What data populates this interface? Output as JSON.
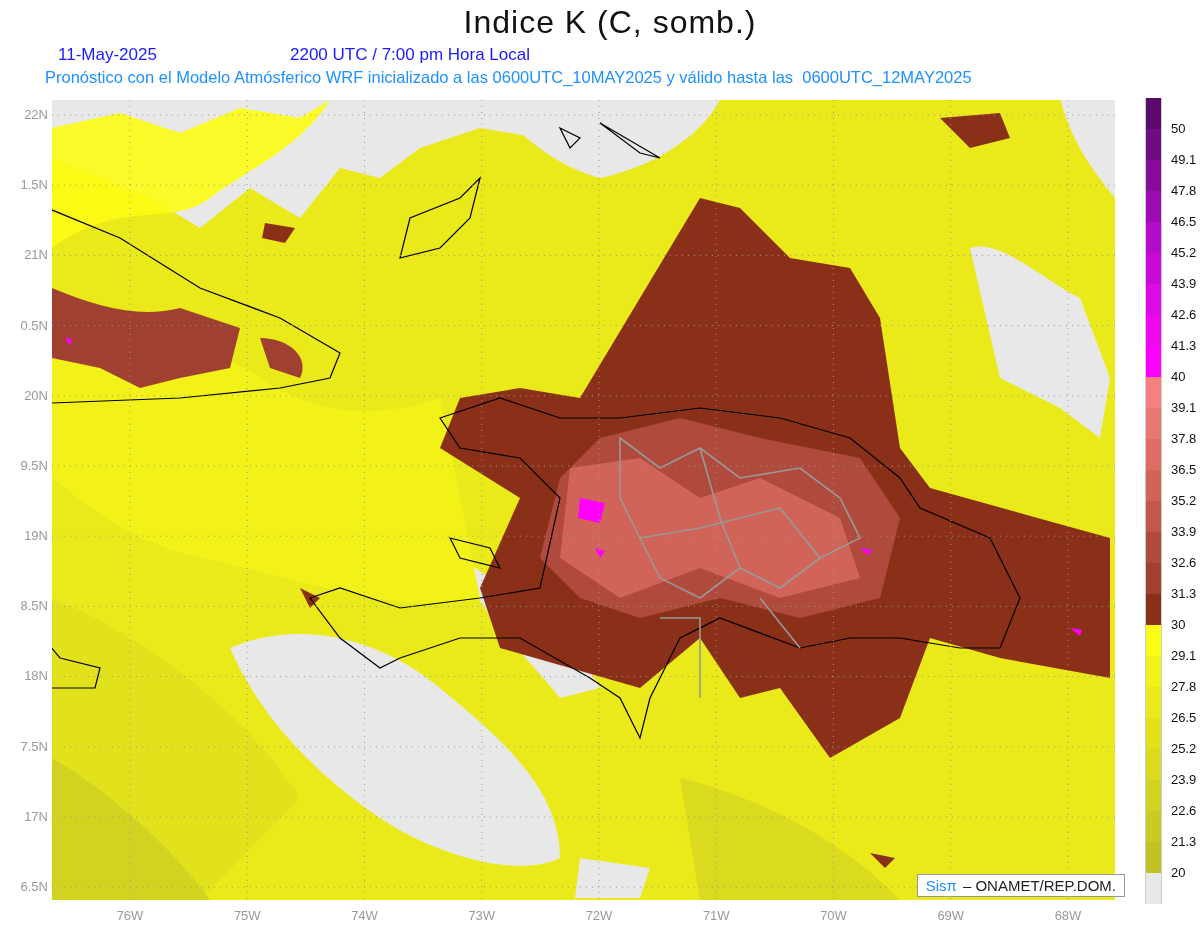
{
  "title": "Indice K (C, somb.)",
  "date": "11-May-2025",
  "time": "2200 UTC / 7:00 pm Hora Local",
  "subtitle": "Pronóstico con el Modelo Atmósferico WRF inicializado a las 0600UTC_10MAY2025 y válido hasta las  0600UTC_12MAY2025",
  "lat_labels": [
    "22N",
    "1.5N",
    "21N",
    "0.5N",
    "20N",
    "9.5N",
    "19N",
    "8.5N",
    "18N",
    "7.5N",
    "17N",
    "6.5N"
  ],
  "lon_labels": [
    "76W",
    "75W",
    "74W",
    "73W",
    "72W",
    "71W",
    "70W",
    "69W",
    "68W"
  ],
  "credit": {
    "brand": "Sisπ",
    "text": "– ONAMET/REP.DOM."
  },
  "colorbar": [
    {
      "label": "50",
      "color": "#5a0a6a"
    },
    {
      "label": "49.1",
      "color": "#6e0c82"
    },
    {
      "label": "47.8",
      "color": "#860c9c"
    },
    {
      "label": "46.5",
      "color": "#9c0cb2"
    },
    {
      "label": "45.2",
      "color": "#b40cc8"
    },
    {
      "label": "43.9",
      "color": "#c80ad6"
    },
    {
      "label": "42.6",
      "color": "#dc0ae4"
    },
    {
      "label": "41.3",
      "color": "#ee08f0"
    },
    {
      "label": "40",
      "color": "#ff00ff"
    },
    {
      "label": "39.1",
      "color": "#f48080"
    },
    {
      "label": "37.8",
      "color": "#e87872"
    },
    {
      "label": "36.5",
      "color": "#dc6c64"
    },
    {
      "label": "35.2",
      "color": "#d06458"
    },
    {
      "label": "33.9",
      "color": "#c2584a"
    },
    {
      "label": "32.6",
      "color": "#b04a3c"
    },
    {
      "label": "31.3",
      "color": "#a04030"
    },
    {
      "label": "30",
      "color": "#8a3018"
    },
    {
      "label": "29.1",
      "color": "#fcfc14"
    },
    {
      "label": "27.8",
      "color": "#f2f218"
    },
    {
      "label": "26.5",
      "color": "#eaea1a"
    },
    {
      "label": "25.2",
      "color": "#e2e21c"
    },
    {
      "label": "23.9",
      "color": "#dada1e"
    },
    {
      "label": "22.6",
      "color": "#d2d220"
    },
    {
      "label": "21.3",
      "color": "#caca22"
    },
    {
      "label": "20",
      "color": "#c2c224"
    },
    {
      "color": "#e8e8e8"
    }
  ]
}
